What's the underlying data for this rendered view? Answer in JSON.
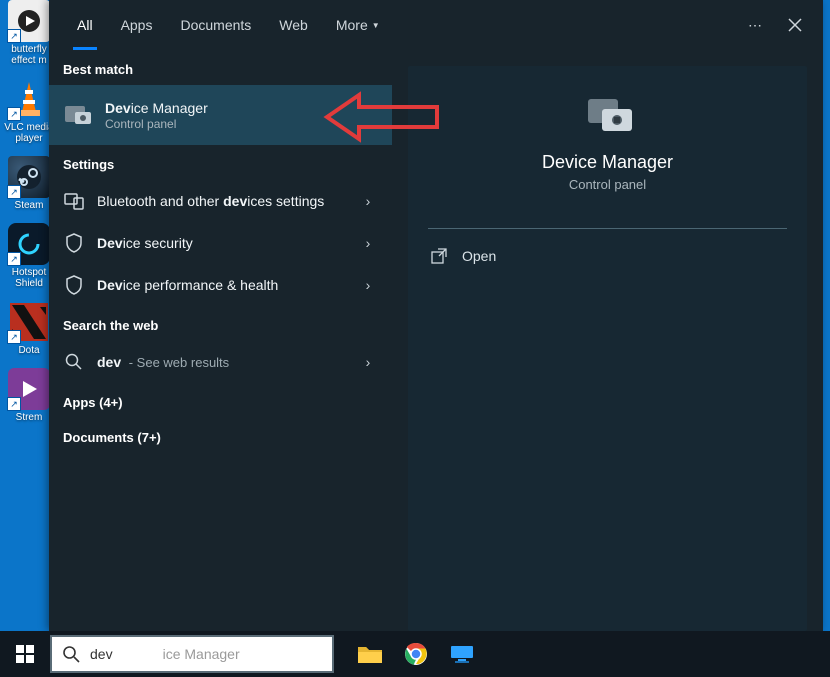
{
  "desktop_icons": [
    {
      "label": "butterfly effect m",
      "color": "#e5e5e5",
      "glyph": "play"
    },
    {
      "label": "VLC media player",
      "color": "#ff7a00",
      "glyph": "cone"
    },
    {
      "label": "Steam",
      "color": "#1b2838",
      "glyph": "steam"
    },
    {
      "label": "Hotspot Shield",
      "color": "#0b75c9",
      "glyph": "ring"
    },
    {
      "label": "Dota",
      "color": "#c0392b",
      "glyph": "dota"
    },
    {
      "label": "Strem",
      "color": "#7d3c98",
      "glyph": "play2"
    }
  ],
  "tabs": {
    "all": "All",
    "apps": "Apps",
    "documents": "Documents",
    "web": "Web",
    "more": "More"
  },
  "sections": {
    "best_match": "Best match",
    "settings": "Settings",
    "search_web": "Search the web"
  },
  "best_match": {
    "title_pre": "Dev",
    "title_rest": "ice Manager",
    "sub": "Control panel"
  },
  "settings_items": [
    {
      "pre": "Bluetooth and other ",
      "bold": "dev",
      "post": "ices settings"
    },
    {
      "pre": "",
      "bold": "Dev",
      "post": "ice security"
    },
    {
      "pre": "",
      "bold": "Dev",
      "post": "ice performance & health"
    }
  ],
  "web_item": {
    "bold": "dev",
    "post": " - See web results"
  },
  "apps_section": "Apps (4+)",
  "docs_section": "Documents (7+)",
  "preview": {
    "title": "Device Manager",
    "sub": "Control panel",
    "open": "Open"
  },
  "search": {
    "typed": "dev",
    "ghost": "ice Manager"
  }
}
